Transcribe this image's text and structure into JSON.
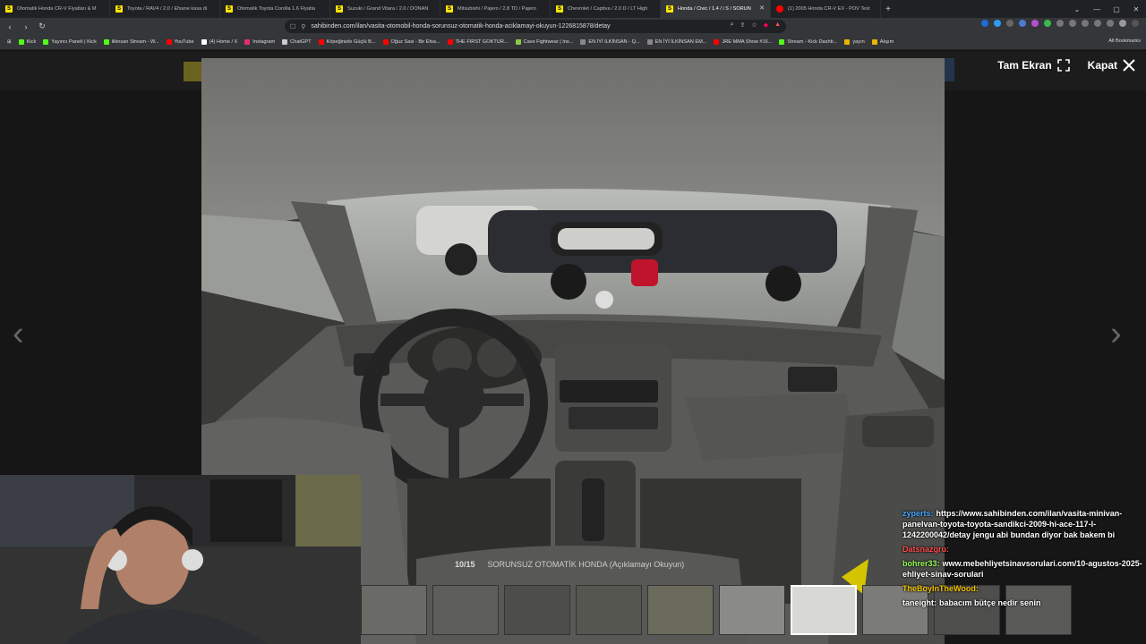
{
  "browser": {
    "tabs": [
      {
        "label": "Otomatik Honda CR-V Fiyatları & M",
        "favicon": "sahibinden-icon",
        "active": false
      },
      {
        "label": "Toyota / RAV4 / 2.0 / Efsane kasa di",
        "favicon": "sahibinden-icon",
        "active": false
      },
      {
        "label": "Otomatik Toyota Corolla 1.6 Fiyatla",
        "favicon": "sahibinden-icon",
        "active": false
      },
      {
        "label": "Suzuki / Grand Vitara / 2.0 / DONAN",
        "favicon": "sahibinden-icon",
        "active": false
      },
      {
        "label": "Mitsubishi / Pajero / 2.8 TD / Pajero",
        "favicon": "sahibinden-icon",
        "active": false
      },
      {
        "label": "Chevrolet / Captiva / 2.0 D / LT High",
        "favicon": "sahibinden-icon",
        "active": false
      },
      {
        "label": "Honda / Civic / 1.4 / i S / SORUN",
        "favicon": "sahibinden-icon",
        "active": true
      },
      {
        "label": "(1) 2005 Honda CR-V EX - POV Test",
        "favicon": "youtube-icon",
        "active": false
      }
    ],
    "url": "sahibinden.com/ilan/vasita-otomobil-honda-sorunsuz-otomatik-honda-aciklamayi-okuyun-1226815878/detay",
    "bookmarks": [
      {
        "label": "Kick",
        "color": "#53fc18"
      },
      {
        "label": "Yayıncı Paneli | Kick",
        "color": "#53fc18"
      },
      {
        "label": "ilkinsan Stream - W...",
        "color": "#53fc18"
      },
      {
        "label": "YouTube",
        "color": "#ff0000"
      },
      {
        "label": "(4) Home / X",
        "color": "#ffffff"
      },
      {
        "label": "Instagram",
        "color": "#e1306c"
      },
      {
        "label": "ChatGPT",
        "color": "#cccccc"
      },
      {
        "label": "Köpeğinizle Güçlü B...",
        "color": "#ff0000"
      },
      {
        "label": "Oğuz Sasi - Bir Efsa...",
        "color": "#ff0000"
      },
      {
        "label": "THE FIRST GOKTUR...",
        "color": "#ff0000"
      },
      {
        "label": "Cave Fightwear | Ins...",
        "color": "#88cc44"
      },
      {
        "label": "EN İYİ İLKİNSAN - Q...",
        "color": "#888888"
      },
      {
        "label": "EN İYİ İLKİNSAN EM...",
        "color": "#888888"
      },
      {
        "label": "JRE MMA Show #16...",
        "color": "#ff0000"
      },
      {
        "label": "Stream - Kick Dashb...",
        "color": "#53fc18"
      },
      {
        "label": "yayın",
        "color": "#e8b500"
      },
      {
        "label": "Alışım",
        "color": "#e8b500"
      }
    ],
    "all_bookmarks": "All Bookmarks"
  },
  "lightbox": {
    "fullscreen_label": "Tam Ekran",
    "close_label": "Kapat",
    "counter": "10/15",
    "caption": "SORUNSUZ OTOMATİK HONDA (Açıklamayı Okuyun)",
    "thumbnail_count": 10,
    "selected_thumbnail": 6
  },
  "chat": [
    {
      "user": "zyperts:",
      "color": "#4aa8ff",
      "text": "https://www.sahibinden.com/ilan/vasita-minivan-panelvan-toyota-toyota-sandikci-2009-hi-ace-117-l-1242200042/detay jengu abi bundan diyor bak bakem bi"
    },
    {
      "user": "Datsnazgru:",
      "color": "#ff4d4d",
      "text": ""
    },
    {
      "user": "bohrer33:",
      "color": "#9aff5c",
      "text": "www.mebehliyetsinavsorulari.com/10-agustos-2025-ehliyet-sinav-sorulari"
    },
    {
      "user": "TheBoyInTheWood:",
      "color": "#f2c200",
      "text": ""
    },
    {
      "user": "taneight:",
      "color": "#ffffff",
      "text": "babacım bütçe nedir senin"
    }
  ]
}
